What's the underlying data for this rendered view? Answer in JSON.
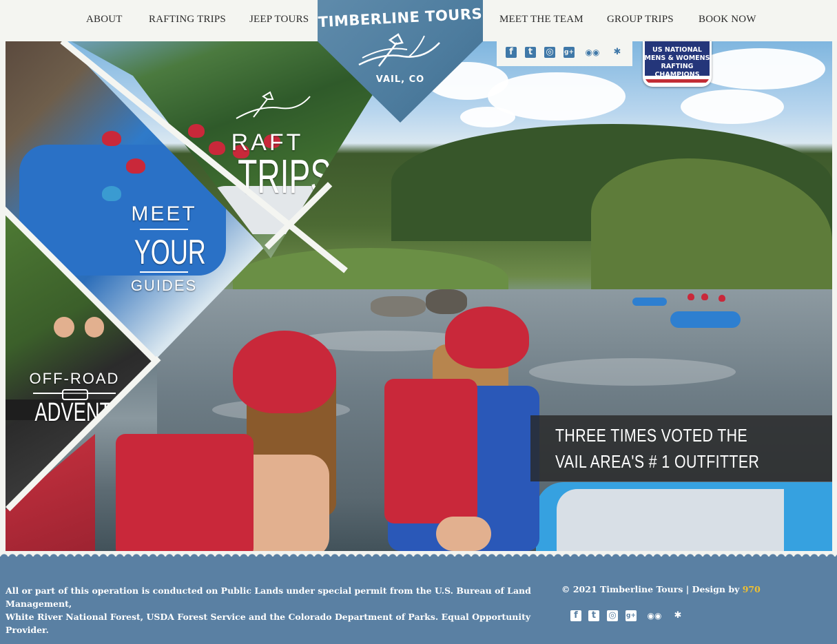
{
  "nav": {
    "left": [
      {
        "label": "ABOUT"
      },
      {
        "label": "RAFTING TRIPS"
      },
      {
        "label": "JEEP TOURS"
      }
    ],
    "right": [
      {
        "label": "MEET THE TEAM"
      },
      {
        "label": "GROUP TRIPS"
      },
      {
        "label": "BOOK NOW"
      }
    ]
  },
  "logo": {
    "title": "TIMBERLINE TOURS",
    "location": "VAIL, CO"
  },
  "social": [
    "facebook-icon",
    "twitter-icon",
    "instagram-icon",
    "google-plus-icon",
    "tripadvisor-icon",
    "yelp-icon"
  ],
  "badge": {
    "lines": [
      "US NATIONAL",
      "MENS & WOMENS",
      "RAFTING",
      "CHAMPIONS"
    ]
  },
  "panels": {
    "raft": {
      "line1": "RAFT",
      "line2": "TRIPS"
    },
    "guides": {
      "line1": "MEET",
      "line2": "YOUR",
      "line3": "GUIDES"
    },
    "jeep": {
      "line1": "OFF-ROAD",
      "line2": "ADVENTURE"
    }
  },
  "banner": {
    "line1": "THREE TIMES VOTED THE",
    "line2": "VAIL AREA'S # 1 OUTFITTER"
  },
  "footer": {
    "notice_line1": "All or part of this operation is conducted on Public Lands under special permit from the U.S. Bureau of Land Management,",
    "notice_line2": "White River National Forest, USDA Forest Service and the Colorado Department of Parks. Equal Opportunity Provider.",
    "copyright": "© 2021 Timberline Tours | Design by ",
    "designer": "970"
  },
  "colors": {
    "brand_blue": "#5a80a3",
    "logo_blue": "#4d7c9e",
    "accent_gold": "#f0c030"
  }
}
